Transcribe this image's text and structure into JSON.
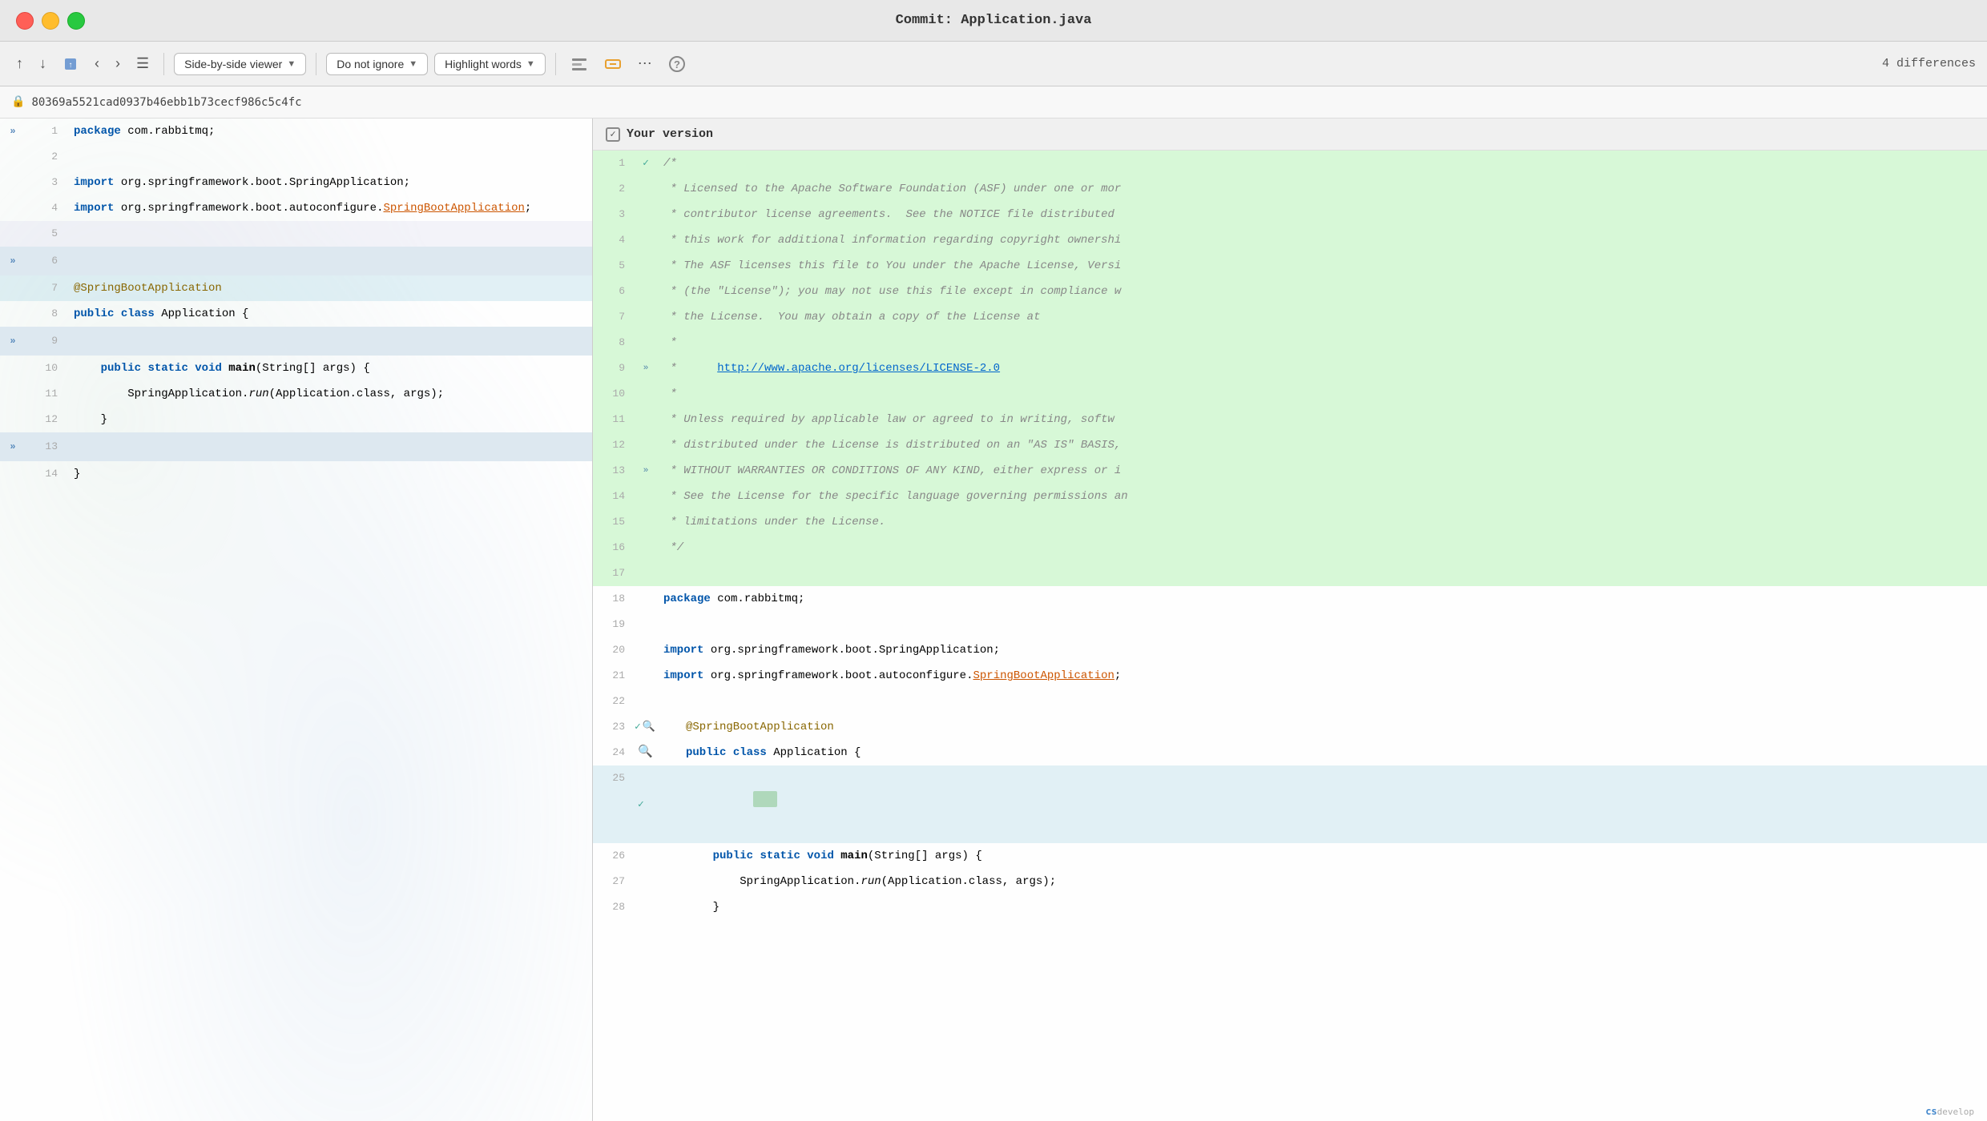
{
  "window": {
    "title": "Commit: Application.java"
  },
  "toolbar": {
    "nav_back": "‹",
    "nav_forward": "›",
    "git_icon": "↑",
    "viewer_label": "Side-by-side viewer",
    "ignore_label": "Do not ignore",
    "highlight_label": "Highlight words",
    "diff_count": "4 differences"
  },
  "commit_hash": "80369a5521cad0937b46ebb1b73cecf986c5c4fc",
  "right_panel": {
    "version_label": "Your version"
  },
  "left_code": [
    {
      "line": 1,
      "content": "package com.rabbitmq;",
      "type": "normal",
      "has_expand": true
    },
    {
      "line": 2,
      "content": "",
      "type": "normal"
    },
    {
      "line": 3,
      "content": "import org.springframework.boot.SpringApplication;",
      "type": "normal"
    },
    {
      "line": 4,
      "content": "import org.springframework.boot.autoconfigure.SpringBootApplication;",
      "type": "normal"
    },
    {
      "line": 5,
      "content": "",
      "type": "empty_diff"
    },
    {
      "line": 6,
      "content": "",
      "type": "expand"
    },
    {
      "line": 7,
      "content": "@SpringBootApplication",
      "type": "annotation_blue"
    },
    {
      "line": 8,
      "content": "public class Application {",
      "type": "normal"
    },
    {
      "line": 9,
      "content": "",
      "type": "expand2"
    },
    {
      "line": 10,
      "content": "    public static void main(String[] args) {",
      "type": "normal"
    },
    {
      "line": 11,
      "content": "        SpringApplication.run(Application.class, args);",
      "type": "normal"
    },
    {
      "line": 12,
      "content": "    }",
      "type": "normal"
    },
    {
      "line": 13,
      "content": "",
      "type": "expand3"
    },
    {
      "line": 14,
      "content": "}",
      "type": "normal"
    }
  ],
  "right_code": [
    {
      "line": 1,
      "content": "/*",
      "type": "green"
    },
    {
      "line": 2,
      "content": " * Licensed to the Apache Software Foundation (ASF) under one or mor",
      "type": "green",
      "comment": true
    },
    {
      "line": 3,
      "content": " * contributor license agreements.  See the NOTICE file distributed",
      "type": "green",
      "comment": true
    },
    {
      "line": 4,
      "content": " * this work for additional information regarding copyright ownershi",
      "type": "green",
      "comment": true
    },
    {
      "line": 5,
      "content": " * The ASF licenses this file to You under the Apache License, Versi",
      "type": "green",
      "comment": true
    },
    {
      "line": 6,
      "content": " * (the \"License\"); you may not use this file except in compliance w",
      "type": "green",
      "comment": true
    },
    {
      "line": 7,
      "content": " * the License.  You may obtain a copy of the License at",
      "type": "green",
      "comment": true
    },
    {
      "line": 8,
      "content": " *",
      "type": "green",
      "comment": true
    },
    {
      "line": 9,
      "content": " *      http://www.apache.org/licenses/LICENSE-2.0",
      "type": "green",
      "comment_link": true
    },
    {
      "line": 10,
      "content": " *",
      "type": "green",
      "comment": true
    },
    {
      "line": 11,
      "content": " * Unless required by applicable law or agreed to in writing, softw",
      "type": "green",
      "comment": true
    },
    {
      "line": 12,
      "content": " * distributed under the License is distributed on an \"AS IS\" BASIS,",
      "type": "green",
      "comment": true
    },
    {
      "line": 13,
      "content": " * WITHOUT WARRANTIES OR CONDITIONS OF ANY KIND, either express or i",
      "type": "green",
      "comment": true
    },
    {
      "line": 14,
      "content": " * See the License for the specific language governing permissions an",
      "type": "green",
      "comment": true
    },
    {
      "line": 15,
      "content": " * limitations under the License.",
      "type": "green",
      "comment": true
    },
    {
      "line": 16,
      "content": " */",
      "type": "green",
      "comment": true
    },
    {
      "line": 17,
      "content": "",
      "type": "green"
    },
    {
      "line": 18,
      "content": "package com.rabbitmq;",
      "type": "normal"
    },
    {
      "line": 19,
      "content": "",
      "type": "normal"
    },
    {
      "line": 20,
      "content": "import org.springframework.boot.SpringApplication;",
      "type": "normal"
    },
    {
      "line": 21,
      "content": "import org.springframework.boot.autoconfigure.SpringBootApplication;",
      "type": "normal"
    },
    {
      "line": 22,
      "content": "",
      "type": "normal"
    },
    {
      "line": 23,
      "content": "@SpringBootApplication",
      "type": "check",
      "annotation": true
    },
    {
      "line": 24,
      "content": "public class Application {",
      "type": "search"
    },
    {
      "line": 25,
      "content": "",
      "type": "check_blue"
    },
    {
      "line": 26,
      "content": "    public static void main(String[] args) {",
      "type": "normal"
    },
    {
      "line": 27,
      "content": "        SpringApplication.run(Application.class, args);",
      "type": "normal"
    },
    {
      "line": 28,
      "content": "    }",
      "type": "normal"
    }
  ],
  "bottom": {
    "brand": "develop"
  }
}
